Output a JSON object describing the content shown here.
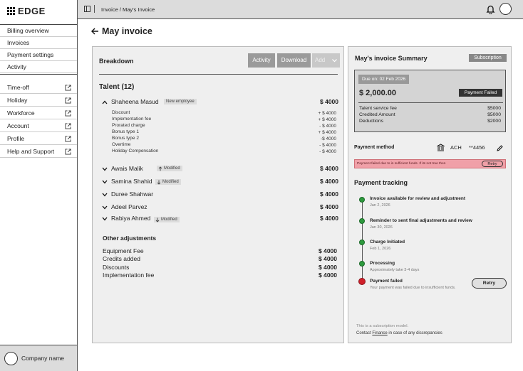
{
  "brand": {
    "name": "EDGE"
  },
  "sidebar": {
    "primary": [
      {
        "label": "Billing overview"
      },
      {
        "label": "Invoices"
      },
      {
        "label": "Payment settings"
      },
      {
        "label": "Activity"
      }
    ],
    "external": [
      {
        "label": "Time-off"
      },
      {
        "label": "Holiday"
      },
      {
        "label": "Workforce"
      },
      {
        "label": "Account"
      },
      {
        "label": "Profile"
      },
      {
        "label": "Help and Support"
      }
    ],
    "company": "Company name"
  },
  "topbar": {
    "breadcrumb": "Invoice / May's Invoice"
  },
  "page": {
    "title": "May invoice"
  },
  "breakdown": {
    "title": "Breakdown",
    "buttons": {
      "activity": "Activity",
      "download": "Download",
      "add": "Add"
    },
    "talent_heading": "Talent (12)",
    "talent": [
      {
        "name": "Shaheena Masud",
        "badge": "New employee",
        "amount": "$ 4000"
      },
      {
        "name": "Awais Malik",
        "badge": "Modified",
        "amount": "$ 4000"
      },
      {
        "name": "Samina Shahid",
        "badge": "Modified",
        "amount": "$ 4000"
      },
      {
        "name": "Duree Shahwar",
        "badge": "",
        "amount": "$ 4000"
      },
      {
        "name": "Adeel Parvez",
        "badge": "",
        "amount": "$ 4000"
      },
      {
        "name": "Rabiya Ahmed",
        "badge": "Modified",
        "amount": "$ 4000"
      }
    ],
    "details": [
      {
        "label": "Discount",
        "amount": "+ $ 4000"
      },
      {
        "label": "Implementation fee",
        "amount": "+ $ 4000"
      },
      {
        "label": "Prorated charge",
        "amount": "- $ 4000"
      },
      {
        "label": "Bonus type 1",
        "amount": "+ $ 4000"
      },
      {
        "label": "Bonus type 2",
        "amount": "-$ 4000"
      },
      {
        "label": "Overtime",
        "amount": "- $ 4000"
      },
      {
        "label": "Holiday Compensation",
        "amount": "- $ 4000"
      }
    ],
    "other_heading": "Other adjustments",
    "other": [
      {
        "label": "Equipment Fee",
        "amount": "$ 4000"
      },
      {
        "label": "Credits added",
        "amount": "$ 4000"
      },
      {
        "label": "Discounts",
        "amount": "$ 4000"
      },
      {
        "label": "Implementation fee",
        "amount": "$ 4000"
      }
    ]
  },
  "summary": {
    "title": "May's invoice Summary",
    "type_badge": "Subscription",
    "due": "Due on: 02 Feb 2026",
    "total": "$ 2,000.00",
    "status": "Payment Failed",
    "lines": [
      {
        "label": "Talent service fee",
        "amount": "$5000"
      },
      {
        "label": "Credited Amount",
        "amount": "$5000"
      },
      {
        "label": "Deductions",
        "amount": "$2000"
      }
    ],
    "payment_method_label": "Payment method",
    "payment_method": "ACH",
    "account_masked": "**4456",
    "alert": "Payment failed due to in sufficient funds. If its not true then",
    "alert_retry": "Retry",
    "tracking_title": "Payment tracking",
    "tracking": [
      {
        "title": "Invoice available for review and adjustment",
        "date": "Jan 2, 2026",
        "status": "done"
      },
      {
        "title": "Reminder to sent final adjustments and review",
        "date": "Jan 30, 2026",
        "status": "done"
      },
      {
        "title": "Charge Initiated",
        "date": "Feb 1, 2026",
        "status": "done"
      },
      {
        "title": "Processing",
        "date": "Approximately take 3-4 days",
        "status": "done"
      },
      {
        "title": "Payment failed",
        "date": "Your payment was failed due to insufficient funds.",
        "status": "failed"
      }
    ],
    "retry": "Retry",
    "footer_note": "This is a subscription model.",
    "footer_contact_prefix": "Contact",
    "footer_contact_link": "Finance",
    "footer_contact_suffix": "in case of any discrepancies"
  },
  "colors": {
    "success": "#2e9a3e",
    "danger": "#d0202a",
    "alert_bg": "#f0a0a8"
  }
}
